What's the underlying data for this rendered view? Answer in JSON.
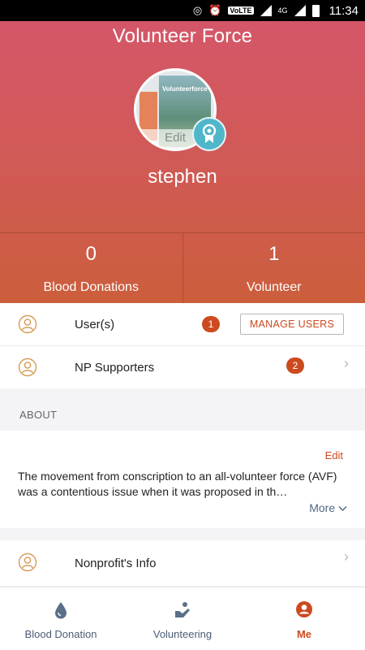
{
  "status_bar": {
    "volte": "VoLTE",
    "network": "4G",
    "time": "11:34"
  },
  "header": {
    "title": "Volunteer Force",
    "avatar_book_title": "Volunteerforce",
    "avatar_edit": "Edit",
    "username": "stephen",
    "stats": [
      {
        "value": "0",
        "label": "Blood Donations"
      },
      {
        "value": "1",
        "label": "Volunteer"
      }
    ]
  },
  "users_row": {
    "label": "User(s)",
    "count": "1",
    "button": "MANAGE USERS"
  },
  "supporters_row": {
    "label": "NP Supporters",
    "count": "2"
  },
  "about": {
    "section": "ABOUT",
    "edit": "Edit",
    "text": "The movement from conscription to an all-volunteer force (AVF) was a contentious issue when it was proposed in th…",
    "more": "More"
  },
  "nonprofit_row": {
    "label": "Nonprofit's Info"
  },
  "nav": {
    "items": [
      {
        "label": "Blood Donation",
        "icon": "blood-drop-icon"
      },
      {
        "label": "Volunteering",
        "icon": "volunteer-hand-icon"
      },
      {
        "label": "Me",
        "icon": "profile-icon"
      }
    ],
    "active": "Me"
  },
  "colors": {
    "accent": "#cc4a20",
    "header_top": "#d5566c",
    "header_bottom": "#cc5e3c",
    "badge_teal": "#4fb7c9"
  }
}
